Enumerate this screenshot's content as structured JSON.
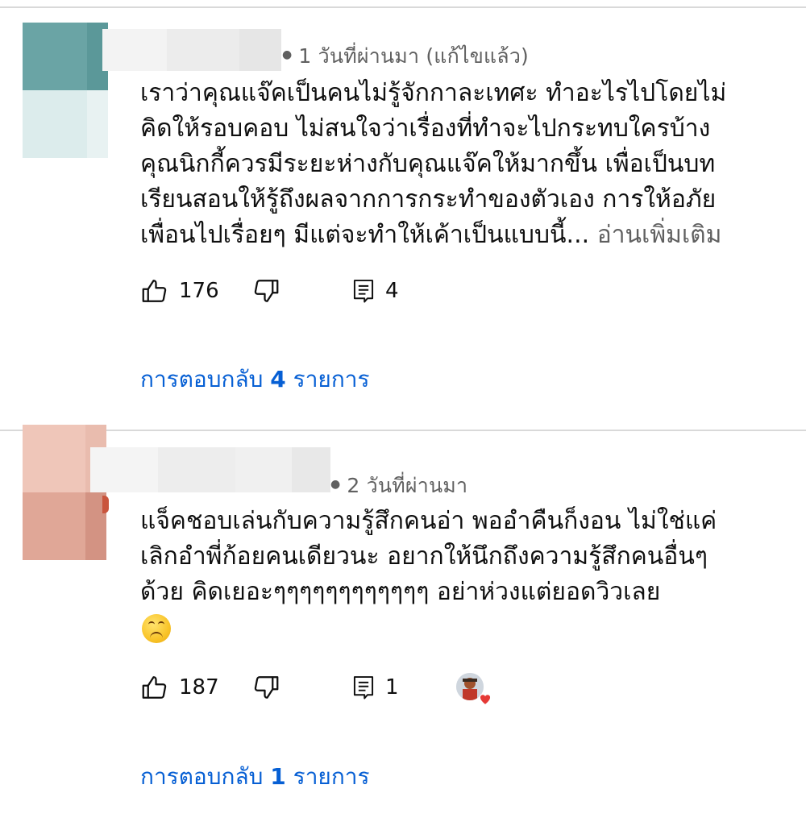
{
  "comments": [
    {
      "meta_text": "1 วันที่ผ่านมา (แก้ไขแล้ว)",
      "lines": [
        "เราว่าคุณแจ๊คเป็นคนไม่รู้จักกาละเทศะ ทำอะไรไปโดยไม่",
        "คิดให้รอบคอบ ไม่สนใจว่าเรื่องที่ทำจะไปกระทบใครบ้าง",
        "คุณนิกกี้ควรมีระยะห่างกับคุณแจ๊คให้มากขึ้น เพื่อเป็นบท",
        "เรียนสอนให้รู้ถึงผลจากการกระทำของตัวเอง  การให้อภัย",
        "เพื่อนไปเรื่อยๆ มีแต่จะทำให้เค้าเป็นแบบนี้..."
      ],
      "read_more": "อ่านเพิ่มเติม",
      "like_count": "176",
      "reply_count": "4",
      "replies_prefix": "การตอบกลับ",
      "replies_number": "4",
      "replies_suffix": "รายการ",
      "colors": {
        "avatar_top": "#5f9fa0",
        "avatar_bottom": "#d9ebeb"
      }
    },
    {
      "meta_text": "2 วันที่ผ่านมา",
      "lines": [
        "แจ็คชอบเล่นกับความรู้สึกคนอ่า พออำคืนก็งอน ไม่ใช่แค่",
        "เลิกอำพี่ก้อยคนเดียวนะ อยากให้นึกถึงความรู้สึกคนอื่นๆ",
        "ด้วย คิดเยอะๆๆๆๆๆๆๆๆๆๆๆๆ อย่าห่วงแต่ยอดวิวเลย"
      ],
      "emoji_icon": "upside-down-face-emoji",
      "like_count": "187",
      "reply_count": "1",
      "replies_prefix": "การตอบกลับ",
      "replies_number": "1",
      "replies_suffix": "รายการ",
      "colors": {
        "avatar_top": "#e8b9a9",
        "avatar_bottom": "#d79a89"
      }
    }
  ],
  "icons": {
    "like": "thumbs-up-icon",
    "dislike": "thumbs-down-icon",
    "reply": "comment-icon",
    "creator_heart": "heart-icon"
  },
  "accent_color": "#065fd4",
  "heart_color": "#e53935"
}
